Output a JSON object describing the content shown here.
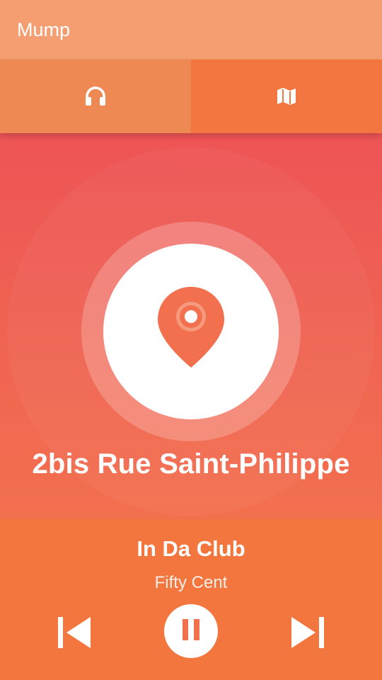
{
  "app": {
    "title": "Mump"
  },
  "tabs": [
    {
      "icon": "headphones-icon",
      "selected": true
    },
    {
      "icon": "map-icon",
      "selected": false
    }
  ],
  "location": {
    "icon": "location-pin-icon",
    "title": "2bis Rue Saint-Philippe"
  },
  "player": {
    "song_title": "In Da Club",
    "artist": "Fifty Cent",
    "state": "playing",
    "controls": [
      "skip-previous-icon",
      "pause-icon",
      "skip-next-icon"
    ]
  },
  "colors": {
    "app_bar": "#f59e71",
    "tab_selected": "#ef8953",
    "tab_unselected": "#f37641",
    "hero_top": "#ee5455",
    "hero_bottom": "#f3704f",
    "player_bg": "#f3763f",
    "accent_icon": "#f3704f"
  }
}
